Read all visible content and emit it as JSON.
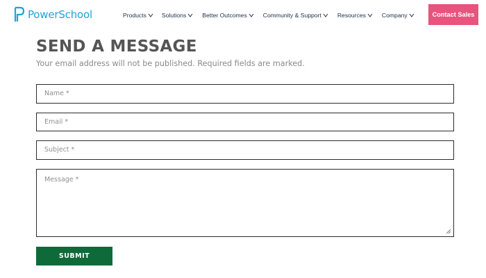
{
  "header": {
    "logo_text": "PowerSchool",
    "nav": [
      {
        "label": "Products"
      },
      {
        "label": "Solutions"
      },
      {
        "label": "Better Outcomes"
      },
      {
        "label": "Community & Support"
      },
      {
        "label": "Resources"
      },
      {
        "label": "Company"
      }
    ],
    "cta_label": "Contact Sales"
  },
  "form": {
    "title": "SEND A MESSAGE",
    "subtitle": "Your email address will not be published. Required fields are marked.",
    "name_placeholder": "Name *",
    "email_placeholder": "Email *",
    "subject_placeholder": "Subject *",
    "message_placeholder": "Message *",
    "submit_label": "SUBMIT"
  },
  "colors": {
    "brand_blue": "#1aa6d8",
    "cta_pink": "#e8547e",
    "submit_green": "#0f6a3a"
  }
}
